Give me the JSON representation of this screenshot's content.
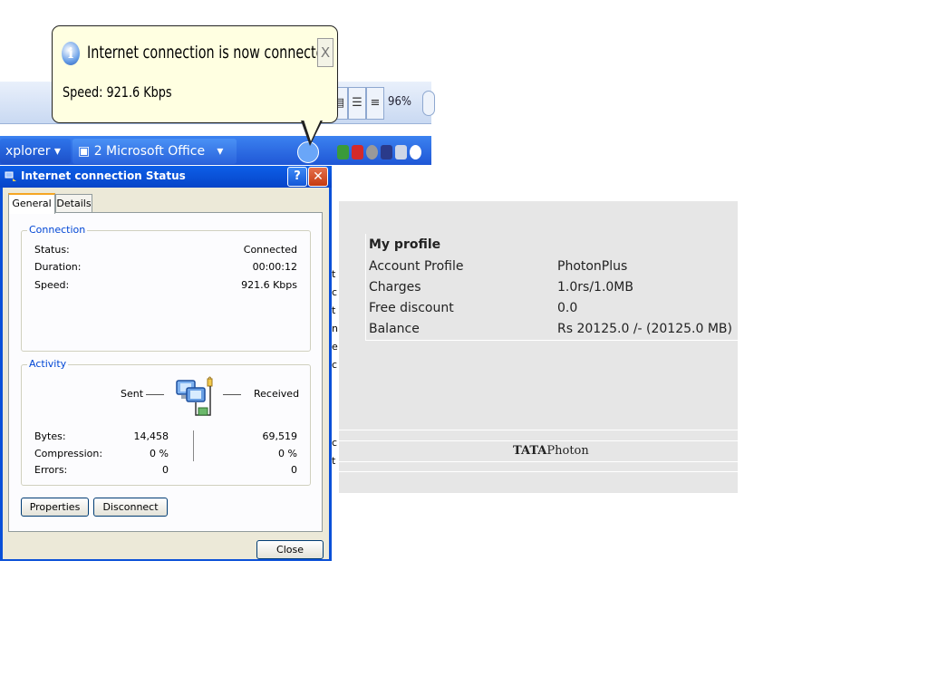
{
  "background": {
    "zoom_label": "96%",
    "taskbar": {
      "explorer_label": "xplorer",
      "office_label": "2 Microsoft Office"
    },
    "side_letters": [
      "t",
      "c",
      "t",
      "n",
      "e",
      "c",
      "c",
      "t"
    ]
  },
  "balloon": {
    "icon": "info-icon",
    "title": "Internet connection is now connected",
    "text": "Speed: 921.6 Kbps",
    "close_glyph": "X"
  },
  "dialog": {
    "title": "Internet connection Status",
    "help_glyph": "?",
    "close_glyph": "✕",
    "tabs": [
      {
        "label": "General",
        "active": true
      },
      {
        "label": "Details",
        "active": false
      }
    ],
    "connection": {
      "group_label": "Connection",
      "rows": [
        {
          "label": "Status:",
          "value": "Connected"
        },
        {
          "label": "Duration:",
          "value": "00:00:12"
        },
        {
          "label": "Speed:",
          "value": "921.6 Kbps"
        }
      ]
    },
    "activity": {
      "group_label": "Activity",
      "sent_label": "Sent",
      "received_label": "Received",
      "rows": [
        {
          "label": "Bytes:",
          "sent": "14,458",
          "received": "69,519"
        },
        {
          "label": "Compression:",
          "sent": "0 %",
          "received": "0 %"
        },
        {
          "label": "Errors:",
          "sent": "0",
          "received": "0"
        }
      ]
    },
    "buttons": {
      "properties": "Properties",
      "disconnect": "Disconnect",
      "close": "Close"
    }
  },
  "profile": {
    "heading": "My profile",
    "rows": [
      {
        "label": "Account Profile",
        "value": "PhotonPlus"
      },
      {
        "label": "Charges",
        "value": "1.0rs/1.0MB"
      },
      {
        "label": "Free discount",
        "value": "0.0"
      },
      {
        "label": "Balance",
        "value": "Rs 20125.0 /- (20125.0 MB)"
      }
    ],
    "brand_bold": "TATA",
    "brand_rest": "Photon"
  },
  "colors": {
    "xp_blue": "#0a50d8",
    "balloon_bg": "#ffffe1",
    "dialog_bg": "#ece9d8",
    "group_label": "#0046d5",
    "profile_bg": "#e6e6e6"
  }
}
